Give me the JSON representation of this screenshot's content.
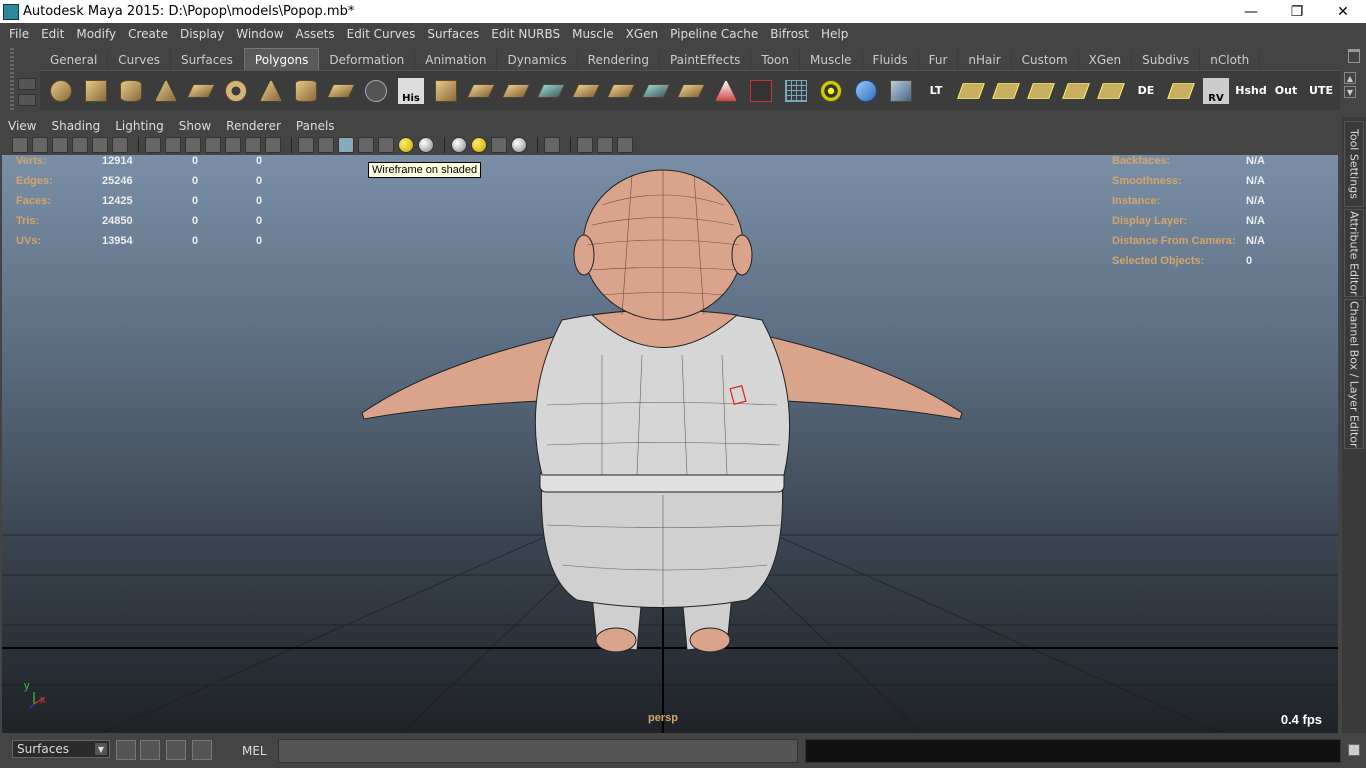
{
  "window": {
    "title": "Autodesk Maya 2015: D:\\Popop\\models\\Popop.mb*",
    "minimize": "—",
    "restore": "❐",
    "close": "✕"
  },
  "menubar": [
    "File",
    "Edit",
    "Modify",
    "Create",
    "Display",
    "Window",
    "Assets",
    "Edit Curves",
    "Surfaces",
    "Edit NURBS",
    "Muscle",
    "XGen",
    "Pipeline Cache",
    "Bifrost",
    "Help"
  ],
  "shelf": {
    "tabs": [
      "General",
      "Curves",
      "Surfaces",
      "Polygons",
      "Deformation",
      "Animation",
      "Dynamics",
      "Rendering",
      "PaintEffects",
      "Toon",
      "Muscle",
      "Fluids",
      "Fur",
      "nHair",
      "Custom",
      "XGen",
      "Subdivs",
      "nCloth"
    ],
    "active_tab": "Polygons",
    "text_icons": {
      "his": "His",
      "lt": "LT",
      "de": "DE",
      "rv": "RV",
      "hshd": "Hshd",
      "out": "Out",
      "ute": "UTE"
    }
  },
  "panel_menu": [
    "View",
    "Shading",
    "Lighting",
    "Show",
    "Renderer",
    "Panels"
  ],
  "tooltip": "Wireframe on shaded",
  "hud_left": [
    {
      "label": "Verts:",
      "v1": "12914",
      "v2": "0",
      "v3": "0"
    },
    {
      "label": "Edges:",
      "v1": "25246",
      "v2": "0",
      "v3": "0"
    },
    {
      "label": "Faces:",
      "v1": "12425",
      "v2": "0",
      "v3": "0"
    },
    {
      "label": "Tris:",
      "v1": "24850",
      "v2": "0",
      "v3": "0"
    },
    {
      "label": "UVs:",
      "v1": "13954",
      "v2": "0",
      "v3": "0"
    }
  ],
  "hud_right": [
    {
      "label": "Backfaces:",
      "value": "N/A"
    },
    {
      "label": "Smoothness:",
      "value": "N/A"
    },
    {
      "label": "Instance:",
      "value": "N/A"
    },
    {
      "label": "Display Layer:",
      "value": "N/A"
    },
    {
      "label": "Distance From Camera:",
      "value": "N/A"
    },
    {
      "label": "Selected Objects:",
      "value": "0"
    }
  ],
  "camera_label": "persp",
  "fps": "0.4 fps",
  "axis": {
    "y": "y",
    "x": "x"
  },
  "side_tabs": [
    "Tool Settings",
    "Attribute Editor",
    "Channel Box / Layer Editor"
  ],
  "command_line": {
    "menu_set": "Surfaces",
    "language": "MEL"
  },
  "colors": {
    "hud_label": "#d4a56a",
    "skin": "#d9a38c",
    "shirt": "#d2d2d2"
  }
}
